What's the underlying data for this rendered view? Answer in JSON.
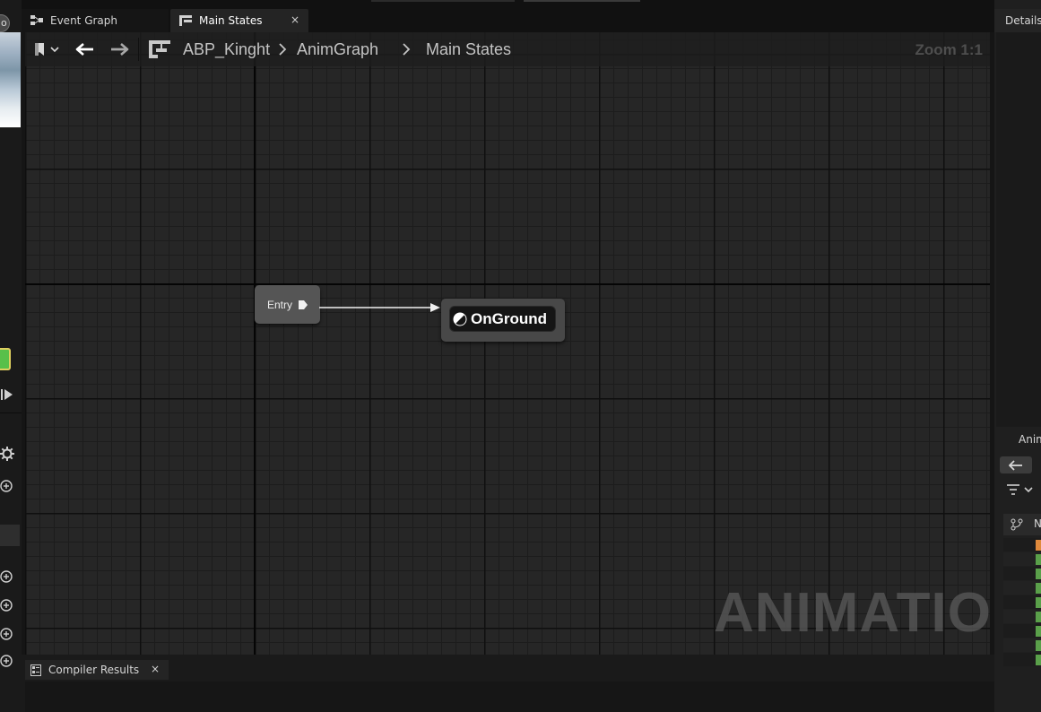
{
  "tabs": [
    {
      "label": "Event Graph",
      "active": false
    },
    {
      "label": "Main States",
      "active": true
    }
  ],
  "tab_close_glyph": "×",
  "breadcrumb": {
    "items": [
      "ABP_Kinght",
      "AnimGraph",
      "Main States"
    ]
  },
  "zoom_label": "Zoom 1:1",
  "nodes": {
    "entry": {
      "label": "Entry"
    },
    "state": {
      "label": "OnGround"
    }
  },
  "watermark": "ANIMATION",
  "compiler": {
    "tab_label": "Compiler Results"
  },
  "right_panel": {
    "details_label": "Details",
    "anim_label": "Anim",
    "header_label": "N"
  },
  "left_strip": {
    "round_button_label": "o"
  },
  "icons": {
    "event_graph_tab": "event-graph-icon",
    "main_states_tab": "state-machine-icon",
    "bookmark": "bookmark-icon",
    "back": "arrow-left-icon",
    "forward": "arrow-right-icon",
    "state_machine": "state-machine-icon",
    "entry_pin": "exec-pin-icon",
    "state": "state-icon",
    "compiler": "compiler-log-icon",
    "details": "pencil-icon"
  },
  "colors": {
    "graph_background": "#262626",
    "active_tab": "#242424",
    "entry_node": "#555555",
    "state_node": "#484848",
    "watermark": "#5a5a5a"
  }
}
